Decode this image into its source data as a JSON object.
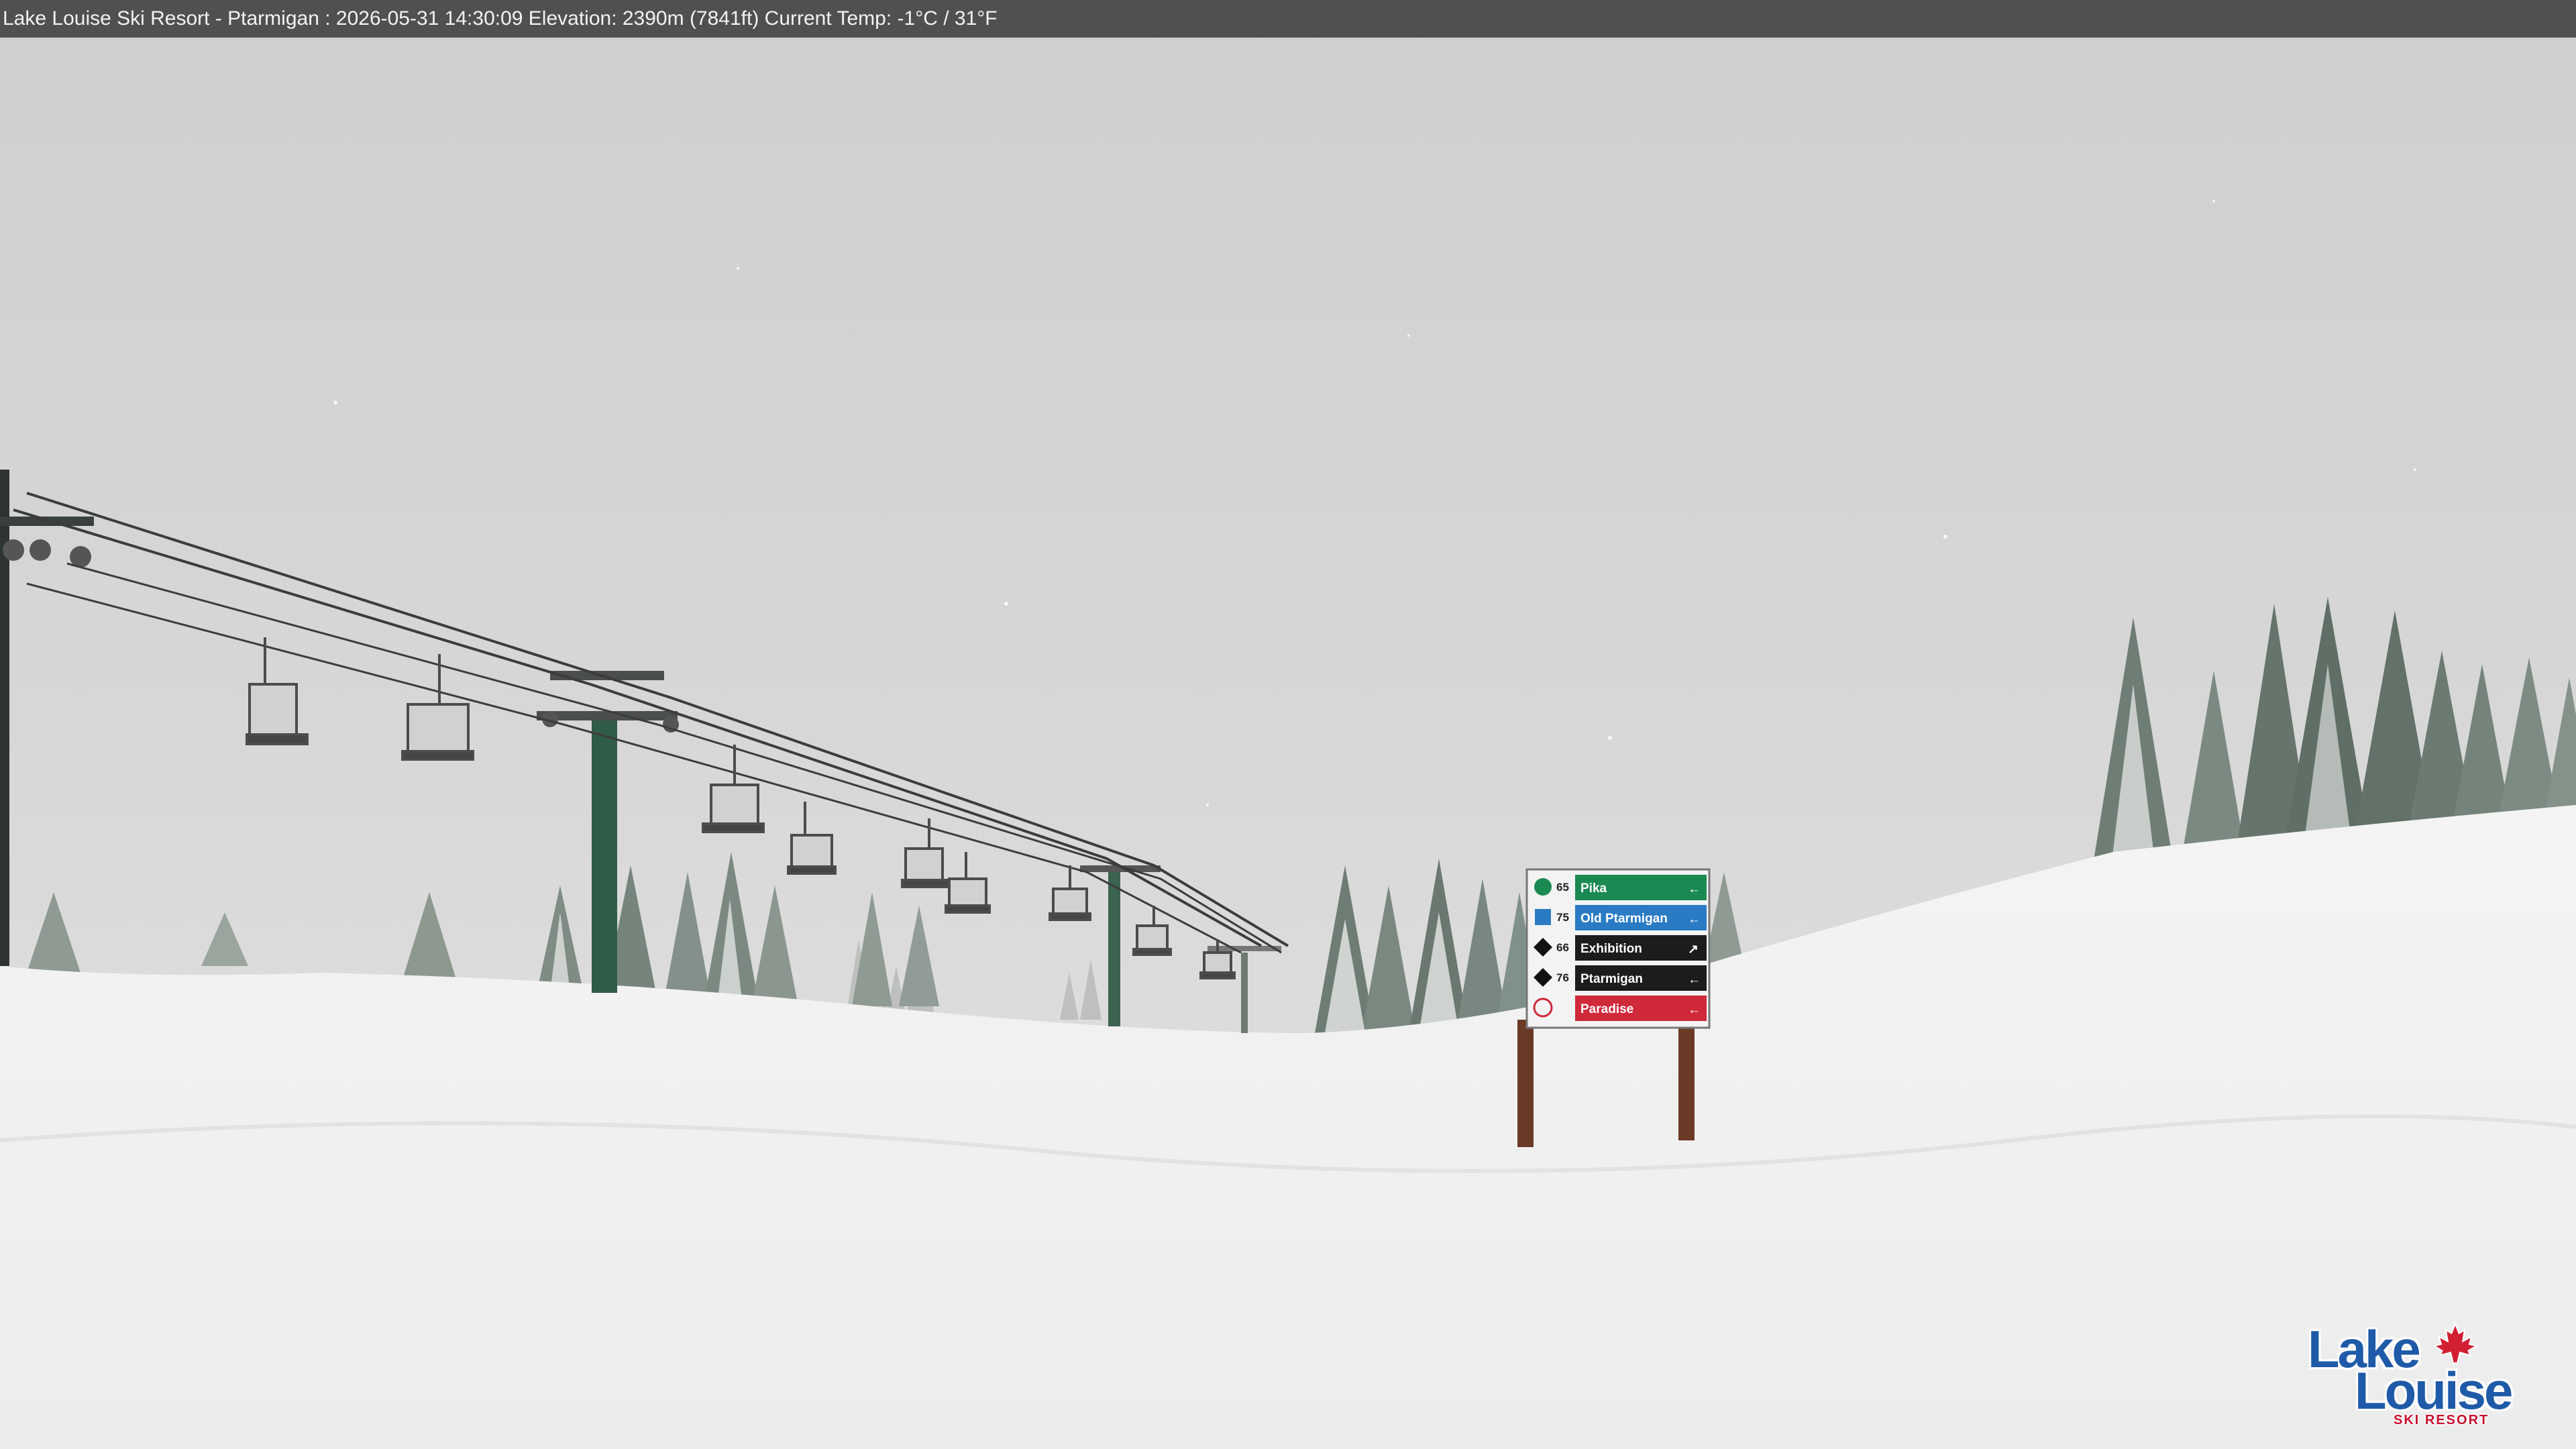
{
  "caption": "Lake Louise Ski Resort - Ptarmigan : 2026-05-31 14:30:09  Elevation: 2390m (7841ft) Current Temp: -1°C / 31°F",
  "sign": {
    "runs": [
      {
        "number": "65",
        "name": "Pika",
        "color": "#1a8a52",
        "symbol": "green-circle-icon"
      },
      {
        "number": "75",
        "name": "Old Ptarmigan",
        "color": "#2a7bc4",
        "symbol": "blue-square-icon"
      },
      {
        "number": "66",
        "name": "Exhibition",
        "color": "#1c1c1c",
        "symbol": "black-diamond-icon"
      },
      {
        "number": "76",
        "name": "Ptarmigan",
        "color": "#1c1c1c",
        "symbol": "black-diamond-icon"
      },
      {
        "number": "",
        "name": "Paradise",
        "color": "#d0293a",
        "symbol": "lift-icon"
      }
    ]
  },
  "logo": {
    "line1": "Lake",
    "line2": "Louise",
    "line3": "SKI RESORT"
  }
}
